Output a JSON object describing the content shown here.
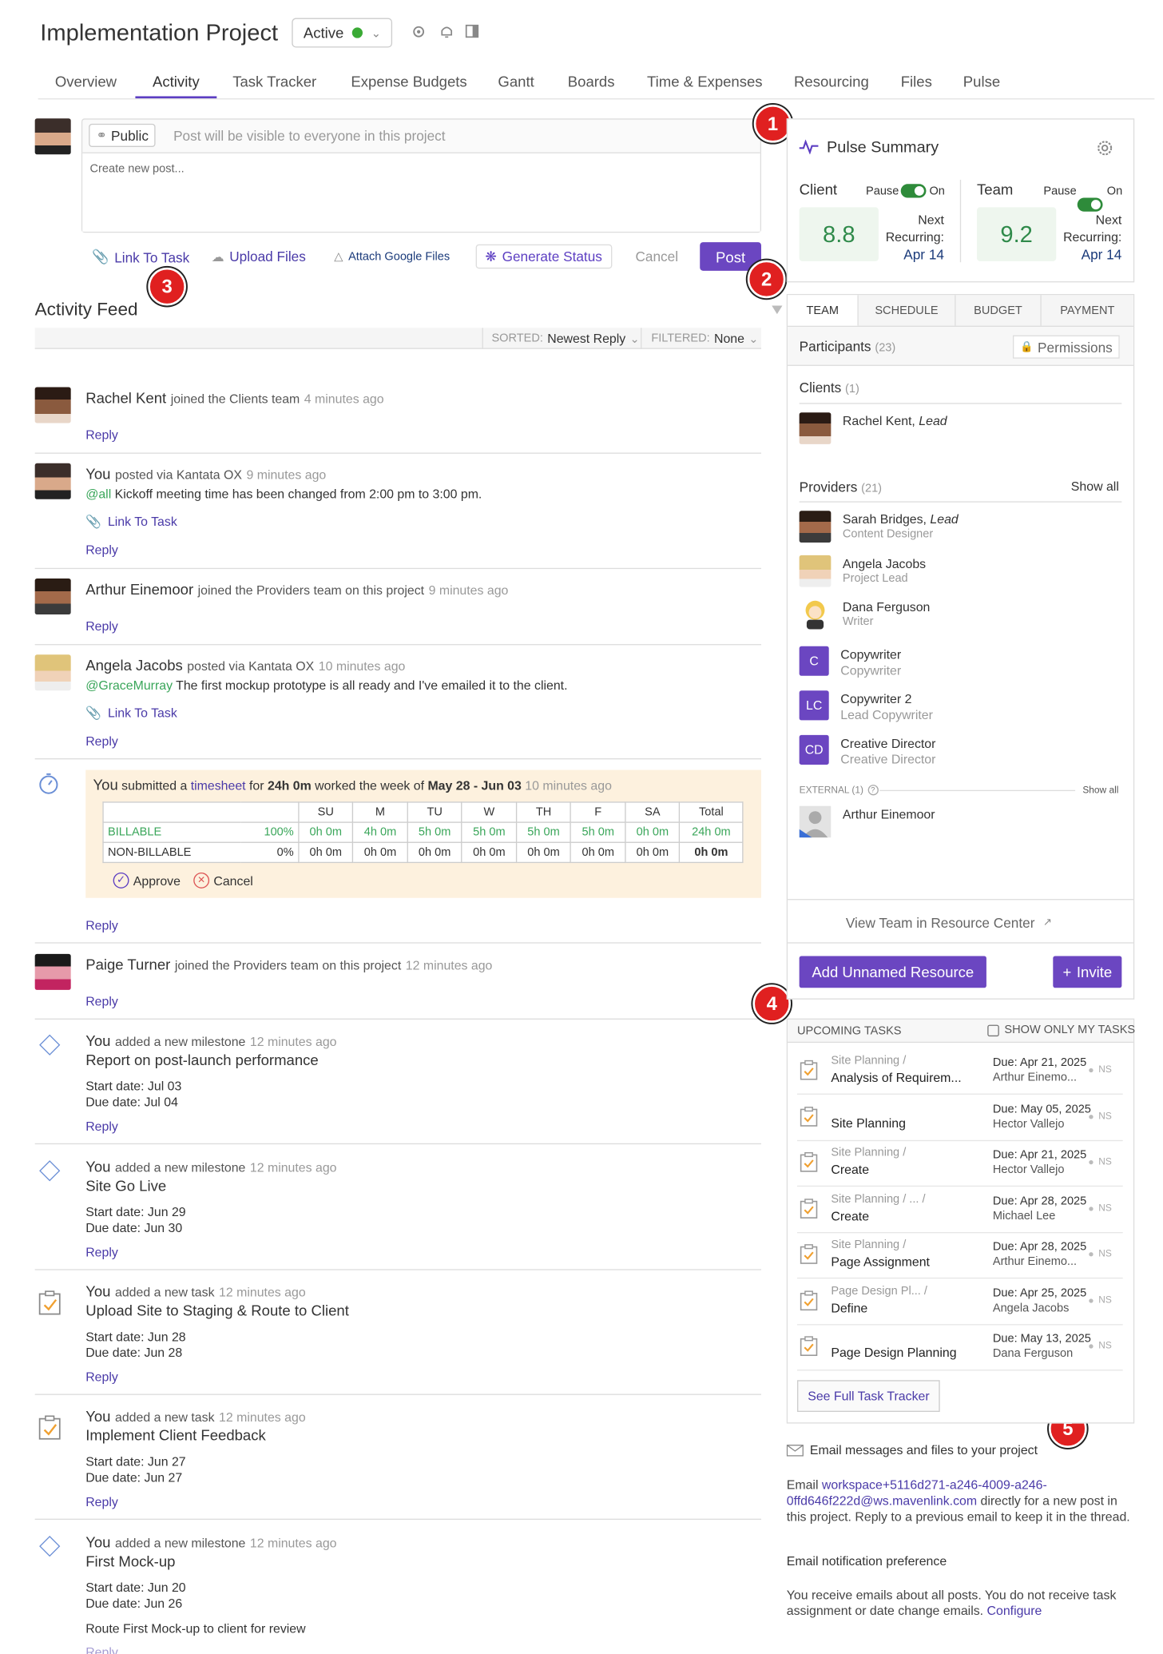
{
  "header": {
    "title": "Implementation Project",
    "status": "Active"
  },
  "tabs": [
    "Overview",
    "Activity",
    "Task Tracker",
    "Expense Budgets",
    "Gantt",
    "Boards",
    "Time & Expenses",
    "Resourcing",
    "Files",
    "Pulse"
  ],
  "composer": {
    "visibility": "Public",
    "visibility_hint": "Post will be visible to everyone in this project",
    "placeholder": "Create new post...",
    "link_task": "Link To Task",
    "upload": "Upload Files",
    "google": "Attach Google Files",
    "generate": "Generate Status",
    "cancel": "Cancel",
    "post": "Post"
  },
  "badges": [
    "1",
    "2",
    "3",
    "4",
    "5"
  ],
  "feed": {
    "title": "Activity Feed",
    "sorted_label": "SORTED:",
    "sorted_value": "Newest Reply",
    "filtered_label": "FILTERED:",
    "filtered_value": "None",
    "reply": "Reply",
    "link_task": "Link To Task",
    "items": [
      {
        "name": "Rachel Kent",
        "action": "joined the Clients team",
        "time": "4 minutes ago"
      },
      {
        "name": "You",
        "action": "posted via Kantata OX",
        "time": "9 minutes ago",
        "mention": "@all",
        "text": "Kickoff meeting time has been changed from 2:00 pm to 3:00 pm."
      },
      {
        "name": "Arthur Einemoor",
        "action": "joined the Providers team on this project",
        "time": "9 minutes ago"
      },
      {
        "name": "Angela Jacobs",
        "action": "posted via Kantata OX",
        "time": "10 minutes ago",
        "mention": "@GraceMurray",
        "text": "The first mockup prototype is all ready and I've emailed it to the client."
      },
      {
        "name": "Paige Turner",
        "action": "joined the Providers team on this project",
        "time": "12 minutes ago"
      }
    ],
    "timesheet": {
      "you": "You",
      "pre": "submitted a",
      "link": "timesheet",
      "mid1": "for",
      "hours": "24h 0m",
      "mid2": "worked the week of",
      "week": "May 28 - Jun 03",
      "time": "10 minutes ago",
      "days": [
        "SU",
        "M",
        "TU",
        "W",
        "TH",
        "F",
        "SA",
        "Total"
      ],
      "billable": {
        "label": "BILLABLE",
        "pct": "100%",
        "values": [
          "0h 0m",
          "4h 0m",
          "5h 0m",
          "5h 0m",
          "5h 0m",
          "5h 0m",
          "0h 0m",
          "24h 0m"
        ]
      },
      "nonbillable": {
        "label": "NON-BILLABLE",
        "pct": "0%",
        "values": [
          "0h 0m",
          "0h 0m",
          "0h 0m",
          "0h 0m",
          "0h 0m",
          "0h 0m",
          "0h 0m",
          "0h 0m"
        ]
      },
      "approve": "Approve",
      "cancel": "Cancel"
    },
    "milestones": [
      {
        "you": "You",
        "action": "added a new milestone",
        "time": "12 minutes ago",
        "title": "Report on post-launch performance",
        "start_label": "Start date:",
        "start": "Jul 03",
        "due_label": "Due date:",
        "due": "Jul 04"
      },
      {
        "you": "You",
        "action": "added a new milestone",
        "time": "12 minutes ago",
        "title": "Site Go Live",
        "start_label": "Start date:",
        "start": "Jun 29",
        "due_label": "Due date:",
        "due": "Jun 30"
      },
      {
        "you": "You",
        "action": "added a new task",
        "time": "12 minutes ago",
        "title": "Upload Site to Staging & Route to Client",
        "start_label": "Start date:",
        "start": "Jun 28",
        "due_label": "Due date:",
        "due": "Jun 28"
      },
      {
        "you": "You",
        "action": "added a new task",
        "time": "12 minutes ago",
        "title": "Implement Client Feedback",
        "start_label": "Start date:",
        "start": "Jun 27",
        "due_label": "Due date:",
        "due": "Jun 27"
      },
      {
        "you": "You",
        "action": "added a new milestone",
        "time": "12 minutes ago",
        "title": "First Mock-up",
        "start_label": "Start date:",
        "start": "Jun 20",
        "due_label": "Due date:",
        "due": "Jun 26",
        "note": "Route First Mock-up to client for review",
        "reply_partial": "Reply"
      }
    ]
  },
  "pulse": {
    "title": "Pulse Summary",
    "client": {
      "label": "Client",
      "pause": "Pause",
      "on": "On",
      "score": "8.8",
      "next": "Next",
      "recurring": "Recurring:",
      "date": "Apr 14"
    },
    "team": {
      "label": "Team",
      "pause": "Pause",
      "on": "On",
      "score": "9.2",
      "next": "Next",
      "recurring": "Recurring:",
      "date": "Apr 14"
    }
  },
  "team": {
    "tabs": [
      "TEAM",
      "SCHEDULE",
      "BUDGET",
      "PAYMENT"
    ],
    "participants": "Participants",
    "participants_count": "(23)",
    "permissions": "Permissions",
    "clients_label": "Clients",
    "clients_count": "(1)",
    "client": {
      "name": "Rachel Kent,",
      "role": "Lead"
    },
    "providers_label": "Providers",
    "providers_count": "(21)",
    "show_all": "Show all",
    "providers": [
      {
        "name": "Sarah Bridges,",
        "lead": "Lead",
        "title": "Content Designer"
      },
      {
        "name": "Angela Jacobs",
        "title": "Project Lead"
      },
      {
        "name": "Dana Ferguson",
        "title": "Writer"
      },
      {
        "initials": "C",
        "name": "Copywriter",
        "title": "Copywriter"
      },
      {
        "initials": "LC",
        "name": "Copywriter 2",
        "title": "Lead Copywriter"
      },
      {
        "initials": "CD",
        "name": "Creative Director",
        "title": "Creative Director"
      }
    ],
    "external_label": "EXTERNAL (1)",
    "external_q": "?",
    "external_show_all": "Show all",
    "external": "Arthur Einemoor",
    "view_rc": "View Team in Resource Center",
    "add_unnamed": "Add Unnamed Resource",
    "invite": "Invite"
  },
  "upcoming": {
    "title": "UPCOMING TASKS",
    "only_mine": "SHOW ONLY MY TASKS",
    "tasks": [
      {
        "path": "Site Planning /",
        "name": "Analysis of Requirem...",
        "due": "Due: Apr 21, 2025",
        "who": "Arthur Einemo...",
        "st": "NS"
      },
      {
        "path": "",
        "name": "Site Planning",
        "due": "Due: May 05, 2025",
        "who": "Hector Vallejo",
        "st": "NS"
      },
      {
        "path": "Site Planning /",
        "name": "Create",
        "due": "Due: Apr 21, 2025",
        "who": "Hector Vallejo",
        "st": "NS"
      },
      {
        "path": "Site Planning / ... /",
        "name": "Create",
        "due": "Due: Apr 28, 2025",
        "who": "Michael Lee",
        "st": "NS"
      },
      {
        "path": "Site Planning /",
        "name": "Page Assignment",
        "due": "Due: Apr 28, 2025",
        "who": "Arthur Einemo...",
        "st": "NS"
      },
      {
        "path": "Page Design Pl... /",
        "name": "Define",
        "due": "Due: Apr 25, 2025",
        "who": "Angela Jacobs",
        "st": "NS"
      },
      {
        "path": "",
        "name": "Page Design Planning",
        "due": "Due: May 13, 2025",
        "who": "Dana Ferguson",
        "st": "NS"
      }
    ],
    "see_full": "See Full Task Tracker"
  },
  "email": {
    "title": "Email messages and files to your project",
    "pre": "Email",
    "address1": "workspace+5116d271-a246-4009-a246-",
    "address2": "0ffd646f222d@ws.mavenlink.com",
    "post1": "directly for a new post in",
    "post2": "this project. Reply to a previous email to keep it in the thread.",
    "pref_title": "Email notification preference",
    "pref1": "You receive emails about all posts. You do not receive task",
    "pref2": "assignment or date change emails.",
    "configure": "Configure"
  }
}
